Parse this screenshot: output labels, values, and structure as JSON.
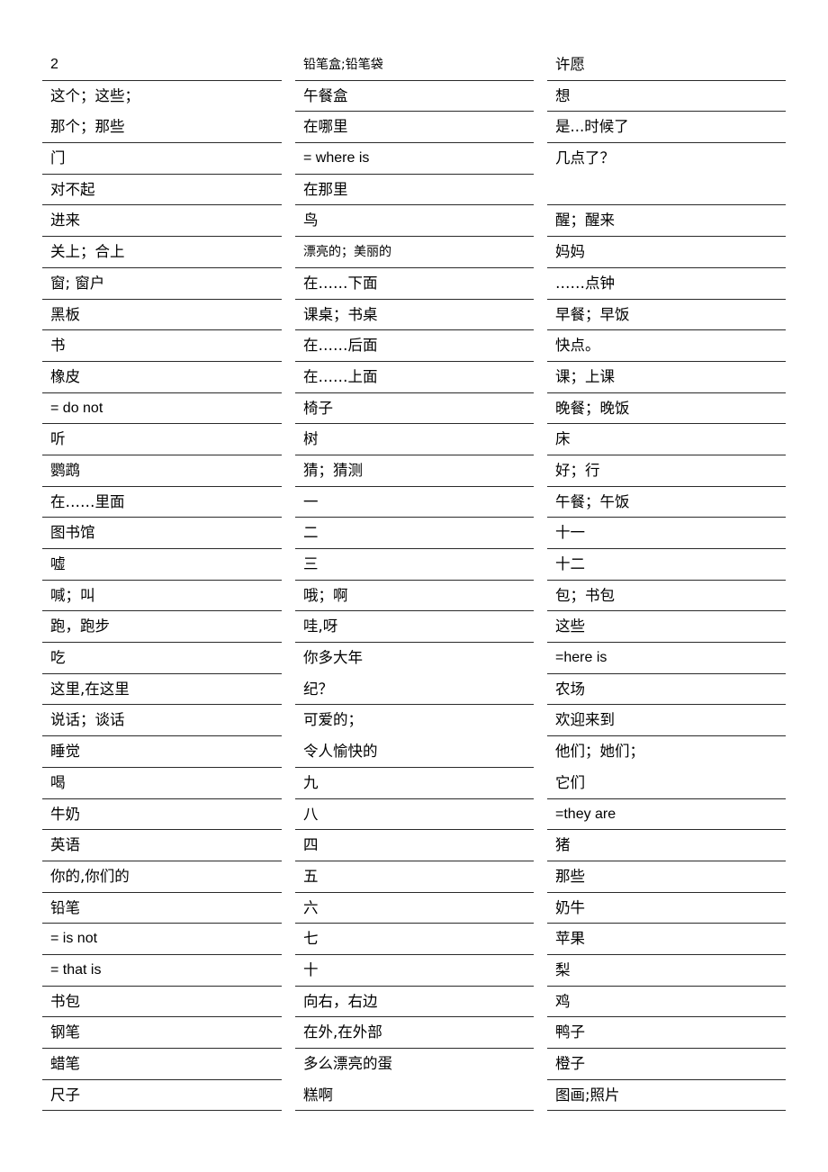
{
  "columns": [
    {
      "cells": [
        {
          "lines": [
            "2"
          ]
        },
        {
          "lines": [
            "这个；这些；",
            "那个；那些"
          ]
        },
        {
          "lines": [
            "门"
          ]
        },
        {
          "lines": [
            "对不起"
          ]
        },
        {
          "lines": [
            "进来"
          ]
        },
        {
          "lines": [
            "关上；合上"
          ]
        },
        {
          "lines": [
            "窗; 窗户"
          ]
        },
        {
          "lines": [
            "黑板"
          ]
        },
        {
          "lines": [
            "书"
          ]
        },
        {
          "lines": [
            "橡皮"
          ]
        },
        {
          "lines": [
            "= do not"
          ]
        },
        {
          "lines": [
            "听"
          ]
        },
        {
          "lines": [
            "鹦鹉"
          ]
        },
        {
          "lines": [
            "在……里面"
          ]
        },
        {
          "lines": [
            "图书馆"
          ]
        },
        {
          "lines": [
            "嘘"
          ]
        },
        {
          "lines": [
            " 喊；叫"
          ]
        },
        {
          "lines": [
            "跑，跑步"
          ]
        },
        {
          "lines": [
            "吃"
          ]
        },
        {
          "lines": [
            "这里,在这里"
          ]
        },
        {
          "lines": [
            "说话；谈话"
          ]
        },
        {
          "lines": [
            "睡觉"
          ]
        },
        {
          "lines": [
            "喝"
          ]
        },
        {
          "lines": [
            "牛奶"
          ]
        },
        {
          "lines": [
            "英语"
          ]
        },
        {
          "lines": [
            "你的,你们的"
          ]
        },
        {
          "lines": [
            "铅笔"
          ]
        },
        {
          "lines": [
            "= is not"
          ]
        },
        {
          "lines": [
            "= that is"
          ]
        },
        {
          "lines": [
            "书包"
          ]
        },
        {
          "lines": [
            "钢笔"
          ]
        },
        {
          "lines": [
            "蜡笔"
          ]
        },
        {
          "lines": [
            "尺子"
          ]
        }
      ]
    },
    {
      "cells": [
        {
          "lines": [
            "铅笔盒;铅笔袋"
          ],
          "small": true
        },
        {
          "lines": [
            "午餐盒"
          ]
        },
        {
          "lines": [
            "在哪里"
          ]
        },
        {
          "lines": [
            " = where is"
          ]
        },
        {
          "lines": [
            "在那里"
          ]
        },
        {
          "lines": [
            "鸟"
          ]
        },
        {
          "lines": [
            "漂亮的；美丽的"
          ],
          "small": true
        },
        {
          "lines": [
            "在……下面"
          ]
        },
        {
          "lines": [
            "课桌；书桌"
          ]
        },
        {
          "lines": [
            "在……后面"
          ]
        },
        {
          "lines": [
            "在……上面"
          ]
        },
        {
          "lines": [
            "椅子"
          ]
        },
        {
          "lines": [
            "树"
          ]
        },
        {
          "lines": [
            "猜；猜测"
          ]
        },
        {
          "lines": [
            "一"
          ]
        },
        {
          "lines": [
            "二"
          ]
        },
        {
          "lines": [
            "三"
          ]
        },
        {
          "lines": [
            "哦；啊"
          ]
        },
        {
          "lines": [
            "哇,呀"
          ]
        },
        {
          "lines": [
            "你多大年",
            "纪？"
          ]
        },
        {
          "lines": [
            "可爱的；",
            "令人愉快的"
          ]
        },
        {
          "lines": [
            "九"
          ]
        },
        {
          "lines": [
            "八"
          ]
        },
        {
          "lines": [
            "四"
          ]
        },
        {
          "lines": [
            "五"
          ]
        },
        {
          "lines": [
            "六"
          ]
        },
        {
          "lines": [
            "七"
          ]
        },
        {
          "lines": [
            "十"
          ]
        },
        {
          "lines": [
            "向右，右边"
          ]
        },
        {
          "lines": [
            "在外,在外部"
          ]
        },
        {
          "lines": [
            "多么漂亮的蛋",
            "糕啊"
          ]
        }
      ]
    },
    {
      "cells": [
        {
          "lines": [
            "许愿"
          ]
        },
        {
          "lines": [
            "想"
          ]
        },
        {
          "lines": [
            "是...时候了"
          ]
        },
        {
          "lines": [
            "几点了？",
            ""
          ]
        },
        {
          "lines": [
            "醒；醒来"
          ]
        },
        {
          "lines": [
            "妈妈"
          ]
        },
        {
          "lines": [
            "……点钟"
          ]
        },
        {
          "lines": [
            "早餐；早饭"
          ]
        },
        {
          "lines": [
            "快点。"
          ]
        },
        {
          "lines": [
            "课；上课"
          ]
        },
        {
          "lines": [
            "晚餐；晚饭"
          ]
        },
        {
          "lines": [
            "床"
          ]
        },
        {
          "lines": [
            "好；行"
          ]
        },
        {
          "lines": [
            "午餐；午饭"
          ]
        },
        {
          "lines": [
            "十一"
          ]
        },
        {
          "lines": [
            "十二"
          ]
        },
        {
          "lines": [
            "包；书包"
          ]
        },
        {
          "lines": [
            "这些"
          ]
        },
        {
          "lines": [
            "=here is"
          ]
        },
        {
          "lines": [
            "农场"
          ]
        },
        {
          "lines": [
            "欢迎来到"
          ]
        },
        {
          "lines": [
            "他们；她们；",
            "它们"
          ]
        },
        {
          "lines": [
            "=they are"
          ]
        },
        {
          "lines": [
            "猪"
          ]
        },
        {
          "lines": [
            "那些"
          ]
        },
        {
          "lines": [
            "奶牛"
          ]
        },
        {
          "lines": [
            "苹果"
          ]
        },
        {
          "lines": [
            "梨"
          ]
        },
        {
          "lines": [
            "鸡"
          ]
        },
        {
          "lines": [
            "鸭子"
          ]
        },
        {
          "lines": [
            "橙子"
          ]
        },
        {
          "lines": [
            "图画;照片"
          ]
        }
      ]
    }
  ]
}
